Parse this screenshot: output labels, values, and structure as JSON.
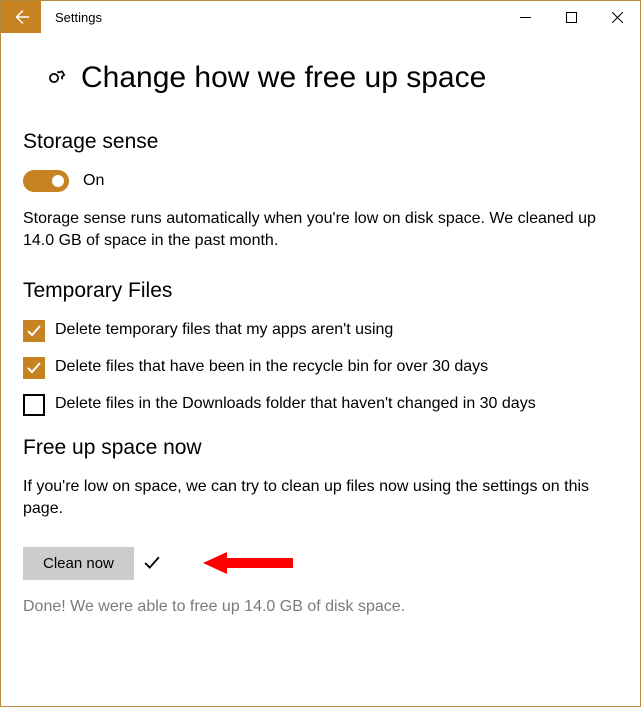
{
  "window": {
    "title": "Settings"
  },
  "page": {
    "title": "Change how we free up space"
  },
  "storage_sense": {
    "heading": "Storage sense",
    "toggle_label": "On",
    "description": "Storage sense runs automatically when you're low on disk space. We cleaned up 14.0 GB of space in the past month."
  },
  "temp_files": {
    "heading": "Temporary Files",
    "options": [
      {
        "label": "Delete temporary files that my apps aren't using",
        "checked": true
      },
      {
        "label": "Delete files that have been in the recycle bin for over 30 days",
        "checked": true
      },
      {
        "label": "Delete files in the Downloads folder that haven't changed in 30 days",
        "checked": false
      }
    ]
  },
  "free_up": {
    "heading": "Free up space now",
    "description": "If you're low on space, we can try to clean up files now using the settings on this page.",
    "button_label": "Clean now",
    "done_text": "Done! We were able to free up 14.0 GB of disk space."
  },
  "colors": {
    "accent": "#c78221"
  }
}
